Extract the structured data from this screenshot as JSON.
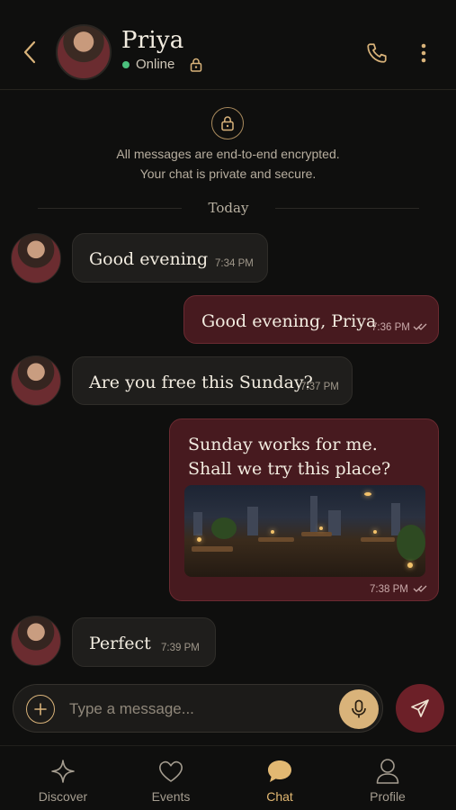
{
  "header": {
    "name": "Priya",
    "status": "Online",
    "icons": {
      "back": "chevron-left-icon",
      "call": "phone-icon",
      "more": "more-vertical-icon",
      "lock": "lock-icon"
    }
  },
  "encryption": {
    "line1": "All messages are end-to-end encrypted.",
    "line2": "Your chat is private and secure."
  },
  "day_label": "Today",
  "messages": [
    {
      "from": "Priya",
      "direction": "incoming",
      "text": "Good evening",
      "time": "7:34 PM"
    },
    {
      "from": "me",
      "direction": "outgoing",
      "text": "Good evening, Priya",
      "time": "7:36 PM",
      "read": true
    },
    {
      "from": "Priya",
      "direction": "incoming",
      "text": "Are you free this Sunday?",
      "time": "7:37 PM"
    },
    {
      "from": "me",
      "direction": "outgoing",
      "text_line1": "Sunday works for me.",
      "text_line2": "Shall we try this place?",
      "attachment": "rooftop restaurant photo",
      "time": "7:38 PM",
      "read": true
    },
    {
      "from": "Priya",
      "direction": "incoming",
      "text": "Perfect",
      "time": "7:39 PM"
    }
  ],
  "composer": {
    "placeholder": "Type a message...",
    "icons": {
      "add": "plus-circle-icon",
      "mic": "microphone-icon",
      "send": "send-icon"
    }
  },
  "nav": {
    "items": [
      {
        "label": "Discover",
        "icon": "sparkle-icon",
        "active": false
      },
      {
        "label": "Events",
        "icon": "heart-icon",
        "active": false
      },
      {
        "label": "Chat",
        "icon": "chat-bubble-icon",
        "active": true
      },
      {
        "label": "Profile",
        "icon": "user-icon",
        "active": false
      }
    ]
  },
  "colors": {
    "background": "#0f0f0e",
    "accent_gold": "#d9b37a",
    "outgoing_bubble": "#471a1f",
    "incoming_bubble": "#1f1e1c",
    "online": "#4bc07d",
    "send_button": "#6c2028"
  }
}
